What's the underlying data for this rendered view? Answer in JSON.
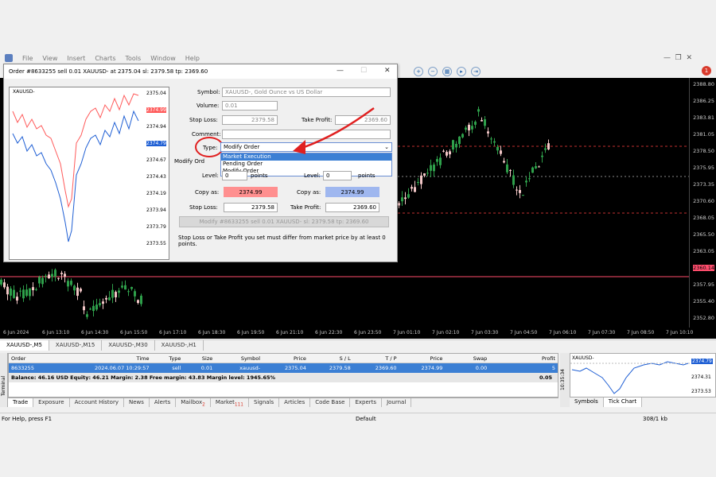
{
  "menu": [
    "File",
    "View",
    "Insert",
    "Charts",
    "Tools",
    "Window",
    "Help"
  ],
  "notification_count": "1",
  "chart": {
    "y_labels": [
      "2388.80",
      "2386.25",
      "2383.81",
      "2381.05",
      "2378.50",
      "2375.95",
      "2373.35",
      "2370.60",
      "2368.05",
      "2365.50",
      "2363.05",
      "2360.14",
      "2357.95",
      "2355.40",
      "2352.80"
    ],
    "x_labels": [
      "6 Jun 2024",
      "6 Jun 13:10",
      "6 Jun 14:30",
      "6 Jun 15:50",
      "6 Jun 17:10",
      "6 Jun 18:30",
      "6 Jun 19:50",
      "6 Jun 21:10",
      "6 Jun 22:30",
      "6 Jun 23:50",
      "7 Jun 01:10",
      "7 Jun 02:10",
      "7 Jun 03:30",
      "7 Jun 04:50",
      "7 Jun 06:10",
      "7 Jun 07:30",
      "7 Jun 08:50",
      "7 Jun 10:10"
    ],
    "price_label": "2360.14",
    "colors": {
      "bull": "#2e9f4a",
      "bear": "#f2c6c6",
      "red_line": "#c03030",
      "price_line": "#ff4d6d"
    }
  },
  "chart_tabs": [
    "XAUUSD-,M5",
    "XAUUSD-,M15",
    "XAUUSD-,M30",
    "XAUUSD-,H1"
  ],
  "dialog": {
    "title": "Order #8633255 sell 0.01 XAUUSD- at 2375.04 sl: 2379.58 tp: 2369.60",
    "preview": {
      "symbol": "XAUUSD-",
      "prices": [
        "2375.04",
        "2374.99",
        "2374.94",
        "2374.79",
        "2374.67",
        "2374.43",
        "2374.19",
        "2373.94",
        "2373.79",
        "2373.55"
      ],
      "ask_badge": "2374.99",
      "bid_badge": "2374.79"
    },
    "symbol_label": "Symbol:",
    "symbol_value": "XAUUSD-, Gold Ounce vs US Dollar",
    "volume_label": "Volume:",
    "volume_value": "0.01",
    "stop_loss_label": "Stop Loss:",
    "stop_loss_value": "2379.58",
    "take_profit_label": "Take Profit:",
    "take_profit_value": "2369.60",
    "comment_label": "Comment:",
    "type_label": "Type:",
    "type_value": "Modify Order",
    "type_options": [
      "Market Execution",
      "Pending Order",
      "Modify Order"
    ],
    "modify_label": "Modify Ord",
    "level_label": "Level:",
    "level_value": "0",
    "points_label": "points",
    "copy_as_label": "Copy as:",
    "copy_sl": "2374.99",
    "copy_tp": "2374.99",
    "sl2_value": "2379.58",
    "tp2_value": "2369.60",
    "modify_button": "Modify #8633255 sell 0.01 XAUUSD- sl: 2379.58 tp: 2369.60",
    "hint": "Stop Loss or Take Profit you set must differ from market price by at least 0 points."
  },
  "terminal": {
    "headers": [
      "Order",
      "Time",
      "Type",
      "Size",
      "Symbol",
      "Price",
      "S / L",
      "T / P",
      "Price",
      "Swap",
      "Profit"
    ],
    "row": [
      "8633255",
      "2024.06.07 10:29:57",
      "sell",
      "0.01",
      "xauusd-",
      "2375.04",
      "2379.58",
      "2369.60",
      "2374.99",
      "0.00",
      "5"
    ],
    "balance": "Balance: 46.16 USD  Equity: 46.21  Margin: 2.38  Free margin: 43.83  Margin level: 1945.65%",
    "balance_profit": "0.05",
    "tabs": [
      "Trade",
      "Exposure",
      "Account History",
      "News",
      "Alerts",
      "Mailbox",
      "Market",
      "Signals",
      "Articles",
      "Code Base",
      "Experts",
      "Journal"
    ],
    "mailbox_badge": "2",
    "market_badge": "111",
    "side_label": "Terminal"
  },
  "mini": {
    "symbol": "XAUUSD-",
    "top_price": "2374.79",
    "mid_price": "2374.31",
    "low_price": "2373.53",
    "time": "10:35:34",
    "tabs": [
      "Symbols",
      "Tick Chart"
    ]
  },
  "status": {
    "help": "For Help, press F1",
    "profile": "Default",
    "traffic": "308/1 kb"
  }
}
